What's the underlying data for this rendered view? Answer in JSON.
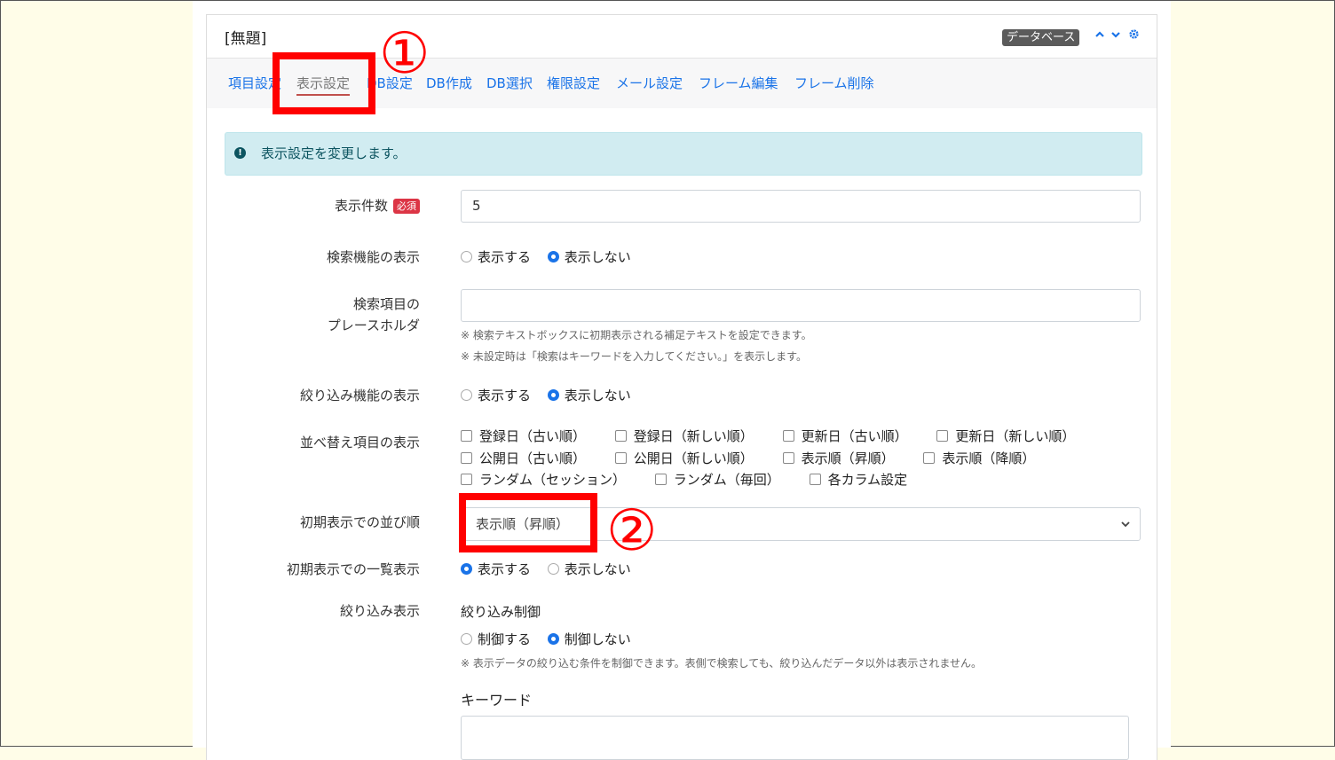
{
  "frame": {
    "title": "[無題]",
    "plugin_badge": "データベース",
    "icons": [
      "chevron-up-icon",
      "chevron-down-icon",
      "gear-icon"
    ]
  },
  "tabs": [
    {
      "label": "項目設定"
    },
    {
      "label": "表示設定",
      "active": true
    },
    {
      "label": "DB設定"
    },
    {
      "label": "DB作成"
    },
    {
      "label": "DB選択"
    },
    {
      "label": "権限設定"
    },
    {
      "label": "メール設定"
    },
    {
      "label": "フレーム編集"
    },
    {
      "label": "フレーム削除"
    }
  ],
  "alert": {
    "text": "表示設定を変更します。",
    "icon": "exclamation-circle-icon"
  },
  "form": {
    "display_count": {
      "label": "表示件数",
      "required_badge": "必須",
      "value": "5"
    },
    "search_display": {
      "label": "検索機能の表示",
      "options": [
        "表示する",
        "表示しない"
      ],
      "selected": "表示しない"
    },
    "placeholder": {
      "label_line1": "検索項目の",
      "label_line2": "プレースホルダ",
      "value": "",
      "hint1": "※ 検索テキストボックスに初期表示される補足テキストを設定できます。",
      "hint2": "※ 未設定時は「検索はキーワードを入力してください。」を表示します。"
    },
    "filter_display": {
      "label": "絞り込み機能の表示",
      "options": [
        "表示する",
        "表示しない"
      ],
      "selected": "表示しない"
    },
    "sort_items": {
      "label": "並べ替え項目の表示",
      "row1": [
        "登録日（古い順）",
        "登録日（新しい順）",
        "更新日（古い順）",
        "更新日（新しい順）"
      ],
      "row2": [
        "公開日（古い順）",
        "公開日（新しい順）",
        "表示順（昇順）",
        "表示順（降順）"
      ],
      "row3": [
        "ランダム（セッション）",
        "ランダム（毎回）",
        "各カラム設定"
      ]
    },
    "initial_sort": {
      "label": "初期表示での並び順",
      "value": "表示順（昇順）"
    },
    "initial_list": {
      "label": "初期表示での一覧表示",
      "options": [
        "表示する",
        "表示しない"
      ],
      "selected": "表示する"
    },
    "filter_control": {
      "label": "絞り込み表示",
      "sub_label": "絞り込み制御",
      "options": [
        "制御する",
        "制御しない"
      ],
      "selected": "制御しない",
      "hint": "※ 表示データの絞り込む条件を制御できます。表側で検索しても、絞り込んだデータ以外は表示されません。",
      "keyword_label": "キーワード"
    }
  },
  "annotations": {
    "marker1": "①",
    "marker2": "②",
    "color": "#ff0000"
  }
}
